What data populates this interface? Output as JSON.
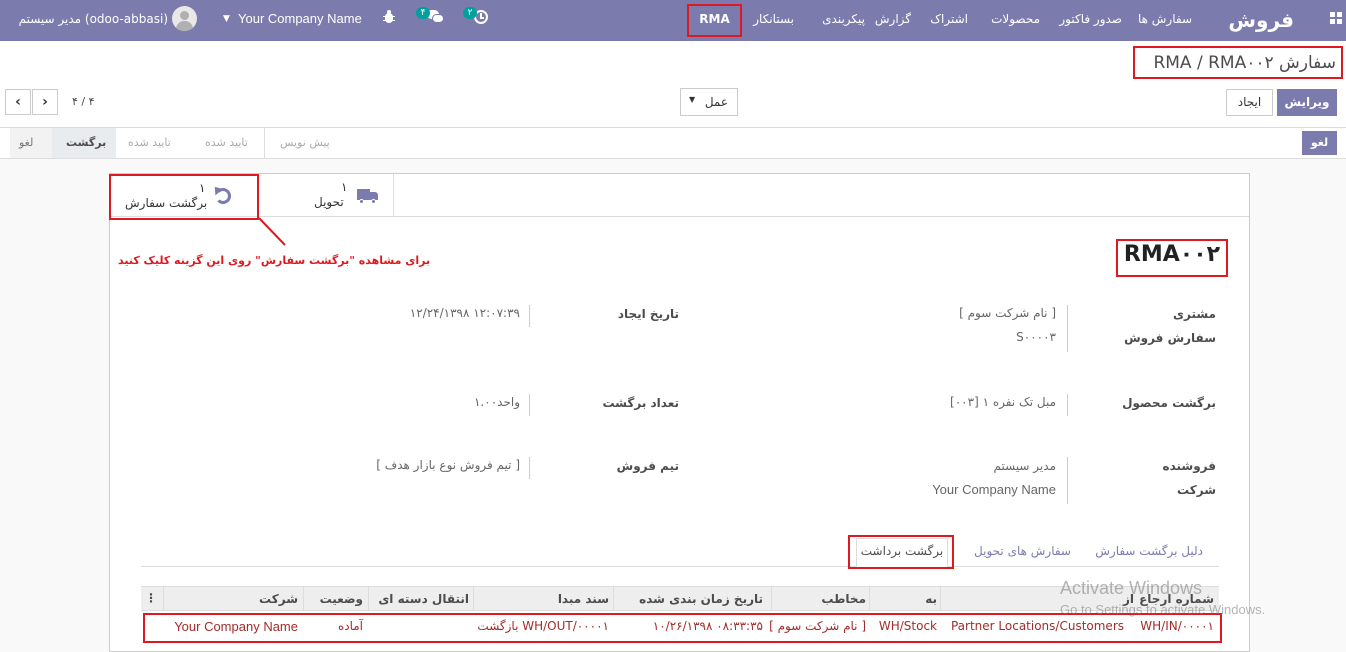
{
  "navbar": {
    "app_title": "فروش",
    "menu": [
      "سفارش ها",
      "صدور فاکتور",
      "محصولات",
      "اشتراک",
      "گزارش",
      "پیکربندی",
      "بستانکار",
      "RMA"
    ],
    "activity_count": "۲",
    "messages_count": "۴",
    "company": "Your Company Name",
    "user": "مدیر سیستم (odoo-abbasi)"
  },
  "breadcrumb": "سفارش RMA / RMA۰۰۲",
  "control": {
    "edit": "ویرایش",
    "create": "ایجاد",
    "action": "عمل",
    "pager": "۴ / ۴"
  },
  "statusbar": {
    "cancel_button": "لغو",
    "stages": [
      "پیش نویس",
      "تایید شده",
      "تایید شده",
      "برگشت",
      "لغو"
    ]
  },
  "smart_buttons": {
    "delivery": {
      "count": "۱",
      "label": "تحویل"
    },
    "return": {
      "count": "۱",
      "label": "برگشت سفارش"
    }
  },
  "annotation": "برای مشاهده \"برگشت سفارش\" روی این گزینه کلیک کنید",
  "record": {
    "name": "RMA۰۰۲",
    "customer_label": "مشتری",
    "customer_value": "[ نام شرکت سوم ]",
    "sale_order_label": "سفارش فروش",
    "sale_order_value": "S۰۰۰۰۳",
    "create_date_label": "تاریخ ایجاد",
    "create_date_value": "۱۲/۲۴/۱۳۹۸ ۱۲:۰۷:۳۹",
    "product_label": "برگشت محصول",
    "product_value": "[۰۰۳] مبل تک نفره ۱",
    "qty_label": "تعداد برگشت",
    "qty_value": "۱.۰۰واحد",
    "salesperson_label": "فروشنده",
    "salesperson_value": "مدیر سیستم",
    "company_label": "شرکت",
    "company_value": "Your Company Name",
    "team_label": "تیم فروش",
    "team_value": "[ تیم فروش نوع بازار هدف ]"
  },
  "tabs": [
    "دلیل برگشت سفارش",
    "سفارش های تحویل",
    "برگشت برداشت"
  ],
  "table": {
    "headers": [
      "شماره ارجاع",
      "از",
      "به",
      "مخاطب",
      "تاریخ زمان بندی شده",
      "سند مبدا",
      "انتقال دسته ای",
      "وضعیت",
      "شرکت"
    ],
    "row": [
      "WH/IN/۰۰۰۰۱",
      "Partner Locations/Customers",
      "WH/Stock",
      "[ نام شرکت سوم ]",
      "۱۰/۲۶/۱۳۹۸ ۰۸:۳۳:۳۵",
      "بازگشت WH/OUT/۰۰۰۰۱",
      "",
      "آماده",
      "Your Company Name"
    ]
  },
  "watermark": {
    "line1": "Activate Windows",
    "line2": "Go to Settings to activate Windows."
  }
}
